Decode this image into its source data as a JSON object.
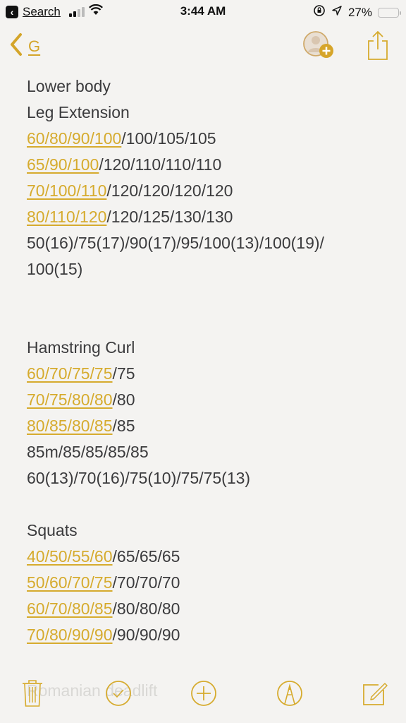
{
  "status_bar": {
    "back_app": "Search",
    "time": "3:44 AM",
    "battery_percent": "27%",
    "battery_level": 0.27,
    "signal_bars": 2,
    "signal_total": 4,
    "icons": [
      "back-app-icon",
      "signal-icon",
      "wifi-icon",
      "orientation-lock-icon",
      "location-icon",
      "battery-icon"
    ]
  },
  "nav": {
    "back_label": "G",
    "icons": [
      "chevron-left-icon",
      "add-people-icon",
      "share-icon"
    ]
  },
  "colors": {
    "accent": "#d6ab2e",
    "text": "#3b3b3d",
    "background": "#f4f3f1"
  },
  "note": {
    "lines": [
      {
        "link": "",
        "text": "Lower body"
      },
      {
        "link": "",
        "text": "Leg Extension"
      },
      {
        "link": "60/80/90/100",
        "text": "/100/105/105"
      },
      {
        "link": "65/90/100",
        "text": "/120/110/110/110"
      },
      {
        "link": "70/100/110",
        "text": "/120/120/120/120"
      },
      {
        "link": "80/110/120",
        "text": "/120/125/130/130"
      },
      {
        "link": "",
        "text": "50(16)/75(17)/90(17)/95/100(13)/100(19)/"
      },
      {
        "link": "",
        "text": "100(15)"
      },
      {
        "link": "",
        "text": ""
      },
      {
        "link": "",
        "text": ""
      },
      {
        "link": "",
        "text": "Hamstring Curl"
      },
      {
        "link": "60/70/75/75",
        "text": "/75"
      },
      {
        "link": "70/75/80/80",
        "text": "/80"
      },
      {
        "link": "80/85/80/85",
        "text": "/85"
      },
      {
        "link": "",
        "text": "85m/85/85/85/85"
      },
      {
        "link": "",
        "text": "60(13)/70(16)/75(10)/75/75(13)"
      },
      {
        "link": "",
        "text": ""
      },
      {
        "link": "",
        "text": "Squats"
      },
      {
        "link": "40/50/55/60",
        "text": "/65/65/65"
      },
      {
        "link": "50/60/70/75",
        "text": "/70/70/70"
      },
      {
        "link": "60/70/80/85",
        "text": "/80/80/80"
      },
      {
        "link": "70/80/90/90",
        "text": "/90/90/90"
      }
    ],
    "faded_text": "Romanian deadlift"
  },
  "toolbar": {
    "items": [
      "trash-icon",
      "checklist-icon",
      "add-icon",
      "markup-icon",
      "compose-icon"
    ]
  }
}
